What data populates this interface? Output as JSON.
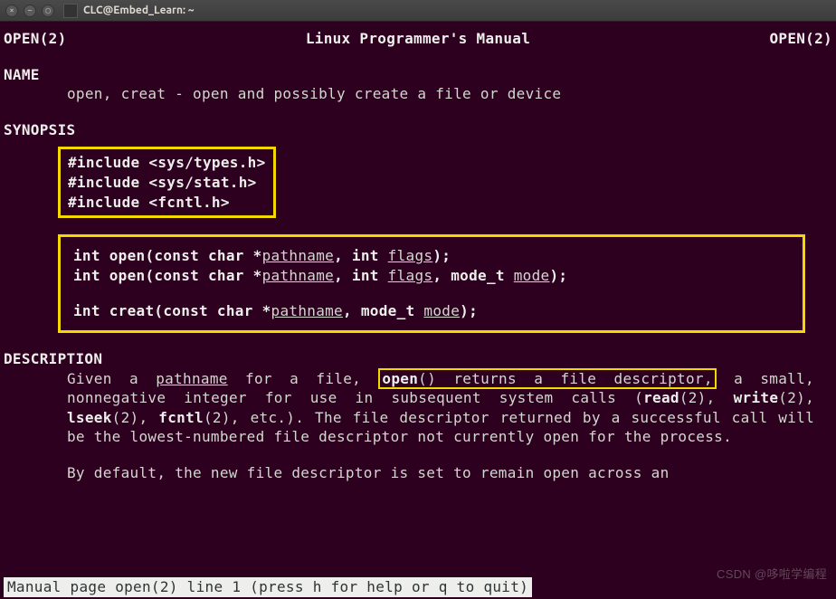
{
  "window": {
    "title": "CLC@Embed_Learn: ~"
  },
  "header": {
    "left": "OPEN(2)",
    "center": "Linux Programmer's Manual",
    "right": "OPEN(2)"
  },
  "sections": {
    "name": {
      "heading": "NAME",
      "text": "open, creat - open and possibly create a file or device"
    },
    "synopsis": {
      "heading": "SYNOPSIS",
      "includes": [
        "#include <sys/types.h>",
        "#include <sys/stat.h>",
        "#include <fcntl.h>"
      ],
      "signatures": {
        "open1": {
          "ret": "int open(const char *",
          "p1": "pathname",
          "mid1": ", int ",
          "p2": "flags",
          "end": ");"
        },
        "open2": {
          "ret": "int open(const char *",
          "p1": "pathname",
          "mid1": ", int ",
          "p2": "flags",
          "mid2": ", mode_t ",
          "p3": "mode",
          "end": ");"
        },
        "creat": {
          "ret": "int creat(const char *",
          "p1": "pathname",
          "mid1": ", mode_t ",
          "p2": "mode",
          "end": ");"
        }
      }
    },
    "description": {
      "heading": "DESCRIPTION",
      "given": "Given  a  ",
      "pathname": "pathname",
      "for_file": "  for  a file, ",
      "open_fn": "open",
      "returns_fd": "() returns a file descriptor,",
      "after_fd": " a",
      "line2a": "small, nonnegative  integer  for  use  in  subsequent  system  calls (",
      "read": "read",
      "n2": "(2),  ",
      "write": "write",
      "n2b": "(2), ",
      "lseek": "lseek",
      "n2c": "(2), ",
      "fcntl": "fcntl",
      "n2d": "(2), etc.).  The file descriptor",
      "line3": "returned by a successful  call  will  be  the  lowest-numbered  file descriptor not currently open for the process.",
      "para2": "By  default, the new file descriptor is set to remain open across an"
    }
  },
  "status": "Manual page open(2) line 1 (press h for help or q to quit)",
  "watermark": "CSDN @哆啦学编程"
}
